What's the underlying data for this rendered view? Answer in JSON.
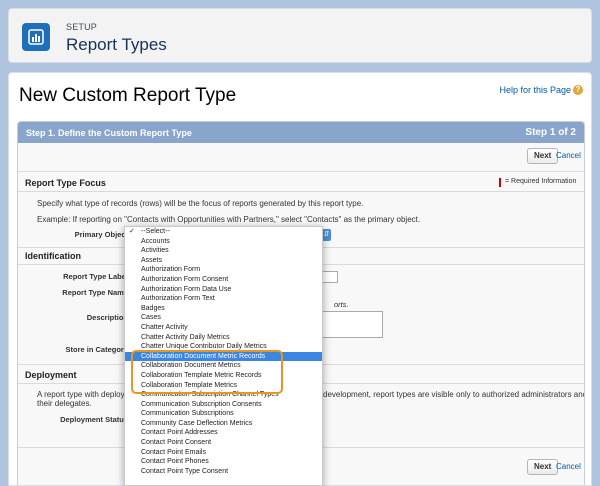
{
  "header": {
    "eyebrow": "SETUP",
    "title": "Report Types"
  },
  "page": {
    "title": "New Custom Report Type",
    "help_link": "Help for this Page",
    "help_icon": "?"
  },
  "step": {
    "title": "Step 1. Define the Custom Report Type",
    "count": "Step 1 of 2"
  },
  "buttons": {
    "next": "Next",
    "cancel": "Cancel"
  },
  "report_type_focus": {
    "title": "Report Type Focus",
    "required_info": "= Required Information",
    "description": "Specify what type of records (rows) will be the focus of reports generated by this report type.",
    "example": "Example: If reporting on \"Contacts with Opportunities with Partners,\" select \"Contacts\" as the primary object.",
    "primary_object_label": "Primary Object"
  },
  "identification": {
    "title": "Identification",
    "report_type_label": "Report Type Label",
    "report_type_name": "Report Type Name",
    "description_label": "Description",
    "description_hint_tail": "orts.",
    "store_in_category": "Store in Category"
  },
  "deployment": {
    "title": "Deployment",
    "text_start": "A report type with deploye",
    "text_end": "development, report types are visible only to authorized administrators and",
    "text_line2": "their delegates.",
    "status_label": "Deployment Status"
  },
  "dropdown": {
    "options": [
      "--Select--",
      "Accounts",
      "Activities",
      "Assets",
      "Authorization Form",
      "Authorization Form Consent",
      "Authorization Form Data Use",
      "Authorization Form Text",
      "Badges",
      "Cases",
      "Chatter Activity",
      "Chatter Activity Daily Metrics",
      "Chatter Unique Contributor Daily Metrics",
      "Collaboration Document Metric Records",
      "Collaboration Document Metrics",
      "Collaboration Template Metric Records",
      "Collaboration Template Metrics",
      "Communication Subscription Channel Types",
      "Communication Subscription Consents",
      "Communication Subscriptions",
      "Community Case Deflection Metrics",
      "Contact Point Addresses",
      "Contact Point Consent",
      "Contact Point Emails",
      "Contact Point Phones",
      "Contact Point Type Consent"
    ],
    "checked_option": "--Select--",
    "selected_option": "Collaboration Document Metric Records"
  },
  "colors": {
    "background": "#b0c4df",
    "step_header": "#8aa5cc",
    "selected": "#3b86e2",
    "highlight": "#e8961f",
    "link": "#015ba7"
  }
}
